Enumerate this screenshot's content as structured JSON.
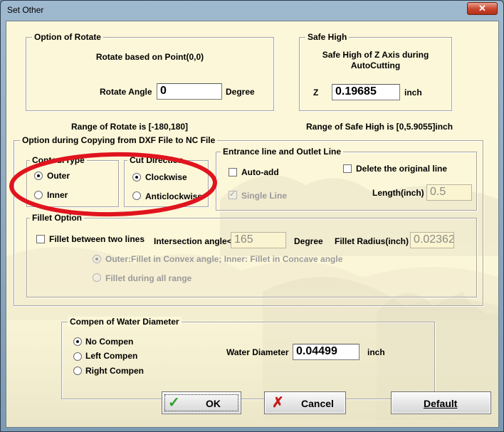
{
  "window": {
    "title": "Set Other",
    "close_icon": "close-icon"
  },
  "rotate": {
    "legend": "Option of Rotate",
    "desc": "Rotate based on Point(0,0)",
    "angle_label": "Rotate Angle",
    "angle_value": "0",
    "unit": "Degree",
    "range": "Range of Rotate is [-180,180]"
  },
  "safe_high": {
    "legend": "Safe High",
    "desc_line1": "Safe High of Z Axis during",
    "desc_line2": "AutoCutting",
    "z_label": "Z",
    "z_value": "0.19685",
    "unit": "inch",
    "range": "Range of Safe High is [0,5.9055]inch"
  },
  "option_group": {
    "legend": "Option during Copying from DXF File to NC File",
    "contour": {
      "legend": "ContourType",
      "outer": "Outer",
      "inner": "Inner",
      "selected": "outer"
    },
    "cut_direction": {
      "legend": "Cut Direction",
      "clockwise": "Clockwise",
      "anticlockwise": "Anticlockwise",
      "selected": "clockwise"
    },
    "entrance": {
      "legend": "Entrance line and Outlet Line",
      "auto_add": "Auto-add",
      "auto_add_checked": false,
      "delete_original": "Delete the original line",
      "delete_original_checked": false,
      "single_line": "Single Line",
      "single_line_checked": true,
      "length_label": "Length(inch)",
      "length_value": "0.5"
    },
    "fillet": {
      "legend": "Fillet Option",
      "between_lines": "Fillet between two lines",
      "between_lines_checked": false,
      "intersection_label": "Intersection angle<",
      "intersection_value": "165",
      "degree": "Degree",
      "radius_label": "Fillet Radius(inch)",
      "radius_value": "0.02362",
      "outer_inner_option": "Outer:Fillet in Convex angle; Inner: Fillet in Concave angle",
      "all_range_option": "Fillet during all range",
      "selected": "outer_inner"
    }
  },
  "compen": {
    "legend": "Compen of Water Diameter",
    "no_compen": "No Compen",
    "left_compen": "Left Compen",
    "right_compen": "Right Compen",
    "selected": "no",
    "water_label": "Water Diameter",
    "water_value": "0.04499",
    "unit": "inch"
  },
  "buttons": {
    "ok": "OK",
    "ok_icon": "checkmark-icon",
    "cancel": "Cancel",
    "cancel_icon": "x-icon",
    "default": "Default"
  },
  "colors": {
    "dialog_background": "#fcf7d9",
    "annotation_ellipse": "#e0141e",
    "ok_check": "#2e9e2e",
    "cancel_x": "#c81818",
    "close_button": "#c9442c"
  }
}
